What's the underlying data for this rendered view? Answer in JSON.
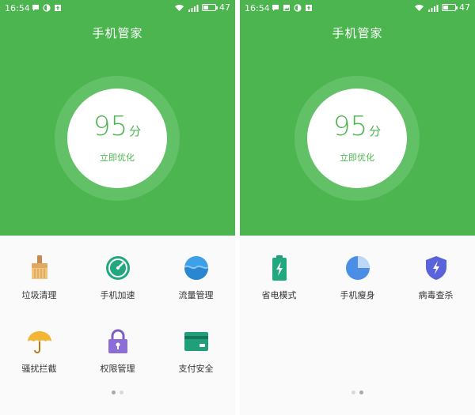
{
  "colors": {
    "brand_green": "#4cb550",
    "ring_green": "#62c066",
    "panel_bg": "#fafafa"
  },
  "screens": [
    {
      "status": {
        "time": "16:54",
        "battery": "47",
        "left_icons": [
          "chat-bubble-icon",
          "half-moon-icon",
          "upload-icon"
        ]
      },
      "title": "手机管家",
      "score": {
        "value": "95",
        "unit": "分",
        "action": "立即优化"
      },
      "tools": [
        {
          "label": "垃圾清理",
          "icon": "broom-icon"
        },
        {
          "label": "手机加速",
          "icon": "speedometer-icon"
        },
        {
          "label": "流量管理",
          "icon": "water-wave-icon"
        },
        {
          "label": "骚扰拦截",
          "icon": "umbrella-icon"
        },
        {
          "label": "权限管理",
          "icon": "padlock-icon"
        },
        {
          "label": "支付安全",
          "icon": "credit-card-icon"
        }
      ],
      "page_active": 0
    },
    {
      "status": {
        "time": "16:54",
        "battery": "47",
        "left_icons": [
          "chat-bubble-icon",
          "image-icon",
          "half-moon-icon",
          "upload-icon"
        ]
      },
      "title": "手机管家",
      "score": {
        "value": "95",
        "unit": "分",
        "action": "立即优化"
      },
      "tools": [
        {
          "label": "省电模式",
          "icon": "battery-bolt-icon"
        },
        {
          "label": "手机瘦身",
          "icon": "pie-chart-icon"
        },
        {
          "label": "病毒查杀",
          "icon": "shield-bolt-icon"
        }
      ],
      "page_active": 1
    }
  ]
}
